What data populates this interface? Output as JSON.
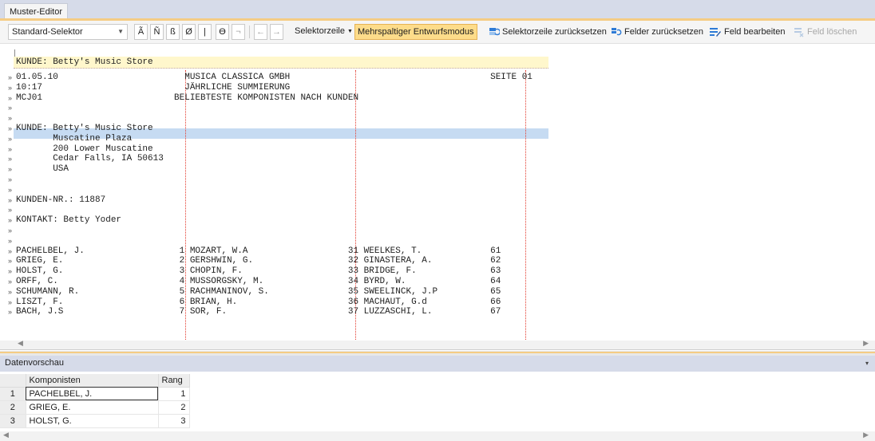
{
  "window": {
    "tab_title": "Muster-Editor"
  },
  "toolbar": {
    "selector_combo": "Standard-Selektor",
    "char_buttons": [
      "Ã",
      "Ñ",
      "ß",
      "Ø",
      "|",
      "ϴ",
      "¬"
    ],
    "arrow_left": "←",
    "arrow_right": "→",
    "selektorzeile_label": "Selektorzeile",
    "mehrspaltig_label": "Mehrspaltiger Entwurfsmodus",
    "reset_selector_label": "Selektorzeile zurücksetzen",
    "reset_fields_label": "Felder zurücksetzen",
    "edit_field_label": "Feld bearbeiten",
    "delete_field_label": "Feld löschen"
  },
  "editor": {
    "selector_line": "KUNDE: Betty's Music Store",
    "gutter_marker": "»",
    "lines": [
      "01.05.10                        MUSICA CLASSICA GMBH                                      SEITE 01",
      "10:17                           JÄHRLICHE SUMMIERUNG",
      "MCJ01                         BELIEBTESTE KOMPONISTEN NACH KUNDEN",
      "",
      "",
      "KUNDE: Betty's Music Store",
      "       Muscatine Plaza",
      "       200 Lower Muscatine",
      "       Cedar Falls, IA 50613",
      "       USA",
      "",
      "",
      "KUNDEN-NR.: 11887",
      "",
      "KONTAKT: Betty Yoder",
      "",
      "",
      "PACHELBEL, J.                  1 MOZART, W.A                   31 WEELKES, T.             61",
      "GRIEG, E.                      2 GERSHWIN, G.                  32 GINASTERA, A.           62",
      "HOLST, G.                      3 CHOPIN, F.                    33 BRIDGE, F.              63",
      "ORFF, C.                       4 MUSSORGSKY, M.                34 BYRD, W.                64",
      "SCHUMANN, R.                   5 RACHMANINOV, S.               35 SWEELINCK, J.P          65",
      "LISZT, F.                      6 BRIAN, H.                     36 MACHAUT, G.d            66",
      "BACH, J.S                      7 SOR, F.                       37 LUZZASCHI, L.           67"
    ],
    "scroll_left": "◀",
    "scroll_right": "▶"
  },
  "preview": {
    "title": "Datenvorschau",
    "collapse_icon": "▾",
    "columns": [
      "Komponisten",
      "Rang"
    ],
    "rows": [
      {
        "n": "1",
        "komponist": "PACHELBEL, J.",
        "rang": "1"
      },
      {
        "n": "2",
        "komponist": "GRIEG, E.",
        "rang": "2"
      },
      {
        "n": "3",
        "komponist": "HOLST, G.",
        "rang": "3"
      }
    ]
  },
  "colors": {
    "tab_strip": "#d6dbe9",
    "accent": "#f5cc84",
    "highlight_mode": "#fddc8a",
    "selector_row": "#fff7cc",
    "selected_line": "#c6dbf2",
    "column_guide": "#e23b2e"
  }
}
